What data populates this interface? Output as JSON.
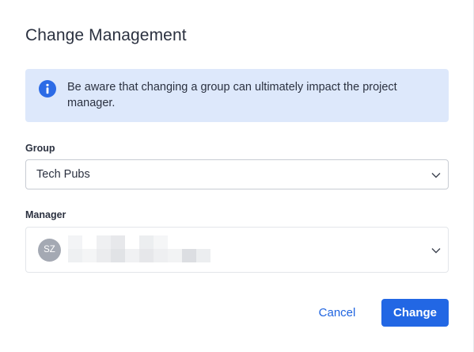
{
  "dialog": {
    "title": "Change Management",
    "info_banner": {
      "icon": "info-icon",
      "message": "Be aware that changing a group can ultimately impact the project manager."
    },
    "group_field": {
      "label": "Group",
      "value": "Tech Pubs",
      "icon": "chevron-down-icon"
    },
    "manager_field": {
      "label": "Manager",
      "avatar_initials": "SZ",
      "name_redacted": true,
      "icon": "chevron-down-icon"
    },
    "buttons": {
      "cancel_label": "Cancel",
      "change_label": "Change"
    }
  },
  "colors": {
    "primary": "#2267e4",
    "link": "#1f64e0",
    "info_bg": "#dde8fb",
    "info_icon": "#2c6be6",
    "avatar_bg": "#a4a9b3",
    "text": "#2b3140"
  }
}
